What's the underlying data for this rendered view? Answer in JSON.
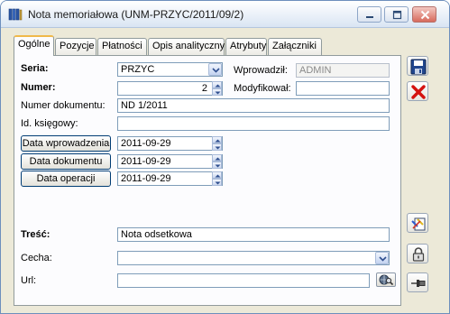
{
  "window": {
    "title": "Nota memoriałowa (UNM-PRZYC/2011/09/2)",
    "accent": "#f0b94a",
    "close_color": "#d76a5c"
  },
  "icons": {
    "app": "documents-icon",
    "minimize": "minimize-icon",
    "maximize": "maximize-icon",
    "close": "close-icon",
    "save": "floppy-disk-icon",
    "cancel": "red-x-icon",
    "ocr": "scan-document-icon",
    "lock": "padlock-icon",
    "pin": "pushpin-icon",
    "url_open": "globe-magnifier-icon"
  },
  "tabs": [
    {
      "label": "Ogólne",
      "active": true
    },
    {
      "label": "Pozycje",
      "active": false
    },
    {
      "label": "Płatności",
      "active": false
    },
    {
      "label": "Opis analityczny",
      "active": false
    },
    {
      "label": "Atrybuty",
      "active": false
    },
    {
      "label": "Załączniki",
      "active": false
    }
  ],
  "form": {
    "seria_label": "Seria:",
    "seria_value": "PRZYC",
    "numer_label": "Numer:",
    "numer_value": "2",
    "numer_dok_label": "Numer dokumentu:",
    "numer_dok_value": "ND 1/2011",
    "id_ksiegowy_label": "Id. księgowy:",
    "id_ksiegowy_value": "",
    "wprowadzil_label": "Wprowadził:",
    "wprowadzil_value": "ADMIN",
    "modyfikowal_label": "Modyfikował:",
    "modyfikowal_value": "",
    "data_wprowadzenia_button": "Data wprowadzenia",
    "data_wprowadzenia_value": "2011-09-29",
    "data_dokumentu_button": "Data dokumentu",
    "data_dokumentu_value": "2011-09-29",
    "data_operacji_button": "Data operacji",
    "data_operacji_value": "2011-09-29",
    "tresc_label": "Treść:",
    "tresc_value": "Nota odsetkowa",
    "cecha_label": "Cecha:",
    "cecha_value": "",
    "url_label": "Url:",
    "url_value": ""
  }
}
